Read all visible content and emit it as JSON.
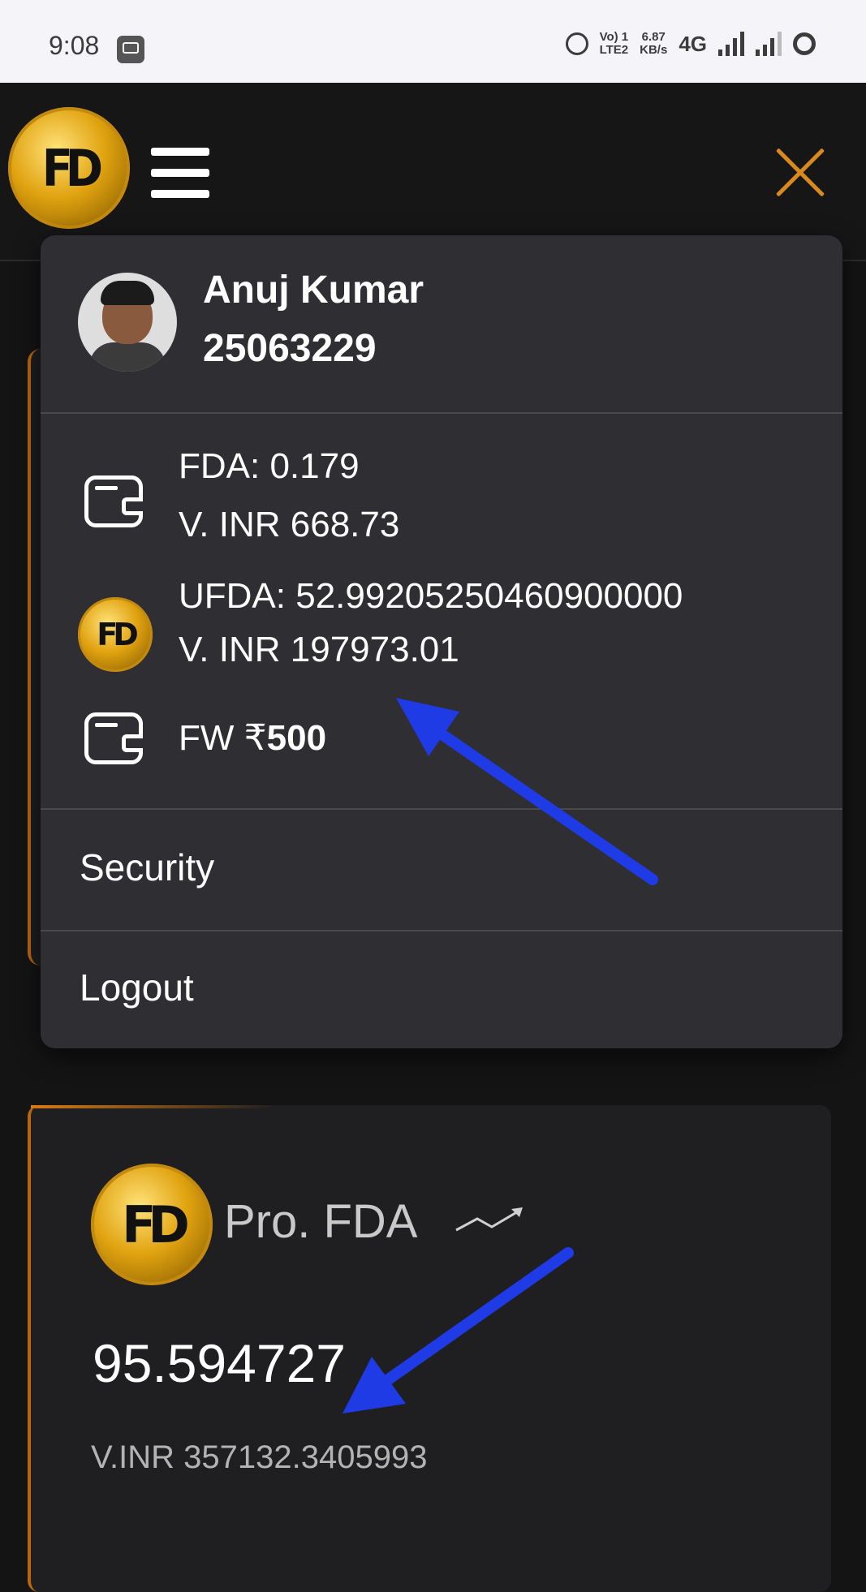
{
  "status_bar": {
    "time": "9:08",
    "network_label_top": "Vo) 1",
    "network_label_bottom": "LTE2",
    "speed_top": "6.87",
    "speed_bottom": "KB/s",
    "network_type": "4G"
  },
  "header": {
    "logo_text": "FD",
    "accent_color": "#d98a1d"
  },
  "menu": {
    "user_name": "Anuj Kumar",
    "user_id": "25063229",
    "fda_balance": "FDA: 0.179",
    "fda_inr": "V. INR 668.73",
    "ufda_balance": "UFDA: 52.99205250460900000",
    "ufda_inr": "V. INR 197973.01",
    "fw_prefix": "FW ₹",
    "fw_amount": "500",
    "items": [
      {
        "label": "Security"
      },
      {
        "label": "Logout"
      }
    ]
  },
  "pro_card": {
    "title": "Pro. FDA",
    "value": "95.594727",
    "inr_value": "V.INR 357132.3405993"
  },
  "colors": {
    "menu_bg": "#2f2f33",
    "page_bg": "#141414",
    "annotation_arrow": "#1f3be6"
  }
}
